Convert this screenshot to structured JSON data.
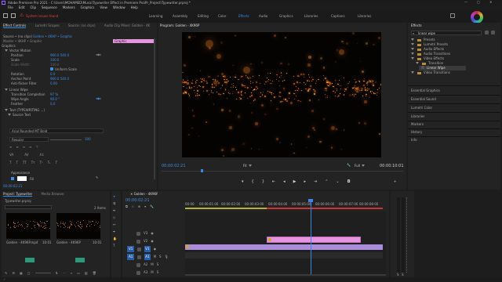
{
  "titlebar": {
    "text": "Adobe Premiere Pro 2021 - C:\\Users\\MOHAMED\\Music\\Typewriter Effect in Premiere Pro\\Pr_Project\\Typewriter.prproj *"
  },
  "menubar": {
    "items": [
      "File",
      "Edit",
      "Clip",
      "Sequence",
      "Markers",
      "Graphics",
      "View",
      "Window",
      "Help"
    ]
  },
  "notice": {
    "text": "System issues found"
  },
  "workspaces": {
    "items": [
      "Learning",
      "Assembly",
      "Editing",
      "Color",
      "Effects",
      "Audio",
      "Graphics",
      "Libraries",
      "Captions",
      "Libraries"
    ],
    "active_index": 4
  },
  "top_left_tabs": {
    "items": [
      "Effect Controls",
      "Lumetri Scopes",
      "Source: (no clips)",
      "Audio Clip Mixer: Golden - 4K"
    ]
  },
  "effect_controls": {
    "source_line": "Source • (no clips)",
    "master": "Master • 4KHP • Graphic",
    "seq": "Golden • 4KHP • Graphic",
    "rows": [
      {
        "label": "Graphics",
        "value": ""
      },
      {
        "label": "Vector Motion",
        "value": ""
      },
      {
        "label": "Position",
        "value": "960.0   540.0"
      },
      {
        "label": "Scale",
        "value": "100.0"
      },
      {
        "label": "Scale Width",
        "value": "100.0"
      },
      {
        "label": "Uniform Scale",
        "value": ""
      },
      {
        "label": "Rotation",
        "value": "0.0"
      },
      {
        "label": "Anchor Point",
        "value": "960.0   540.0"
      },
      {
        "label": "Anti-flicker Filter",
        "value": "0.00"
      },
      {
        "label": "Linear Wipe",
        "value": ""
      },
      {
        "label": "Transition Completion",
        "value": "97 %"
      },
      {
        "label": "Wipe Angle",
        "value": "90.0 °"
      },
      {
        "label": "Feather",
        "value": "0.0"
      },
      {
        "label": "Text (TYPEWRITING ...)",
        "value": ""
      },
      {
        "label": "Source Text",
        "value": ""
      }
    ],
    "font": "Arial Rounded MT Bold",
    "style": "Regular",
    "size": "100",
    "appearance": "Appearance",
    "fill": "Fill",
    "timecode": "00:00:02:21"
  },
  "graphic_clip": {
    "label": "Graphic"
  },
  "program_monitor": {
    "title": "Program: Golden - 4K96P",
    "timecode_left": "00:00:02:21",
    "timecode_right": "00:00:10:01",
    "fit": "Fit",
    "quality": "Full"
  },
  "effects_panel": {
    "title": "Effects",
    "search_value": "linear wipe",
    "tree": [
      {
        "label": "Presets",
        "indent": 1
      },
      {
        "label": "Lumetri Presets",
        "indent": 1
      },
      {
        "label": "Audio Effects",
        "indent": 1
      },
      {
        "label": "Audio Transitions",
        "indent": 1
      },
      {
        "label": "Video Effects",
        "indent": 1
      },
      {
        "label": "Transition",
        "indent": 2
      },
      {
        "label": "Linear Wipe",
        "indent": 3,
        "selected": true
      },
      {
        "label": "Video Transitions",
        "indent": 1
      }
    ],
    "sections": [
      "Essential Graphics",
      "Essential Sound",
      "Lumetri Color",
      "Libraries",
      "Markers",
      "History",
      "Info"
    ]
  },
  "project": {
    "tabs": [
      "Project: Typewriter",
      "Media Browser"
    ],
    "file": "Typewriter.prproj",
    "count": "2 Items",
    "items": [
      {
        "name": "Golden - 4K96P.mp4",
        "duration": "10:01"
      },
      {
        "name": "Golden - 4K96P",
        "duration": "10:01"
      }
    ]
  },
  "timeline": {
    "tab": "Golden - 4K96P",
    "timecode": "00:00:02:21",
    "ruler": [
      "00:00",
      "00:00:01:00",
      "00:00:02:00",
      "00:00:03:00",
      "00:00:04:00",
      "00:00:05:00",
      "00:00:06:00",
      "00:00:07:00",
      "00:00:08:00",
      "00:00:09:00"
    ],
    "tracks": [
      "V3",
      "V2",
      "V1",
      "A1",
      "A2",
      "A3"
    ],
    "audio_label": "Audio 1"
  },
  "colors": {
    "accent": "#2d8ceb",
    "graphic_clip": "#e694e0",
    "video_clip": "#a98ddb",
    "playhead": "#3b87e8",
    "notice": "#e0423c"
  }
}
